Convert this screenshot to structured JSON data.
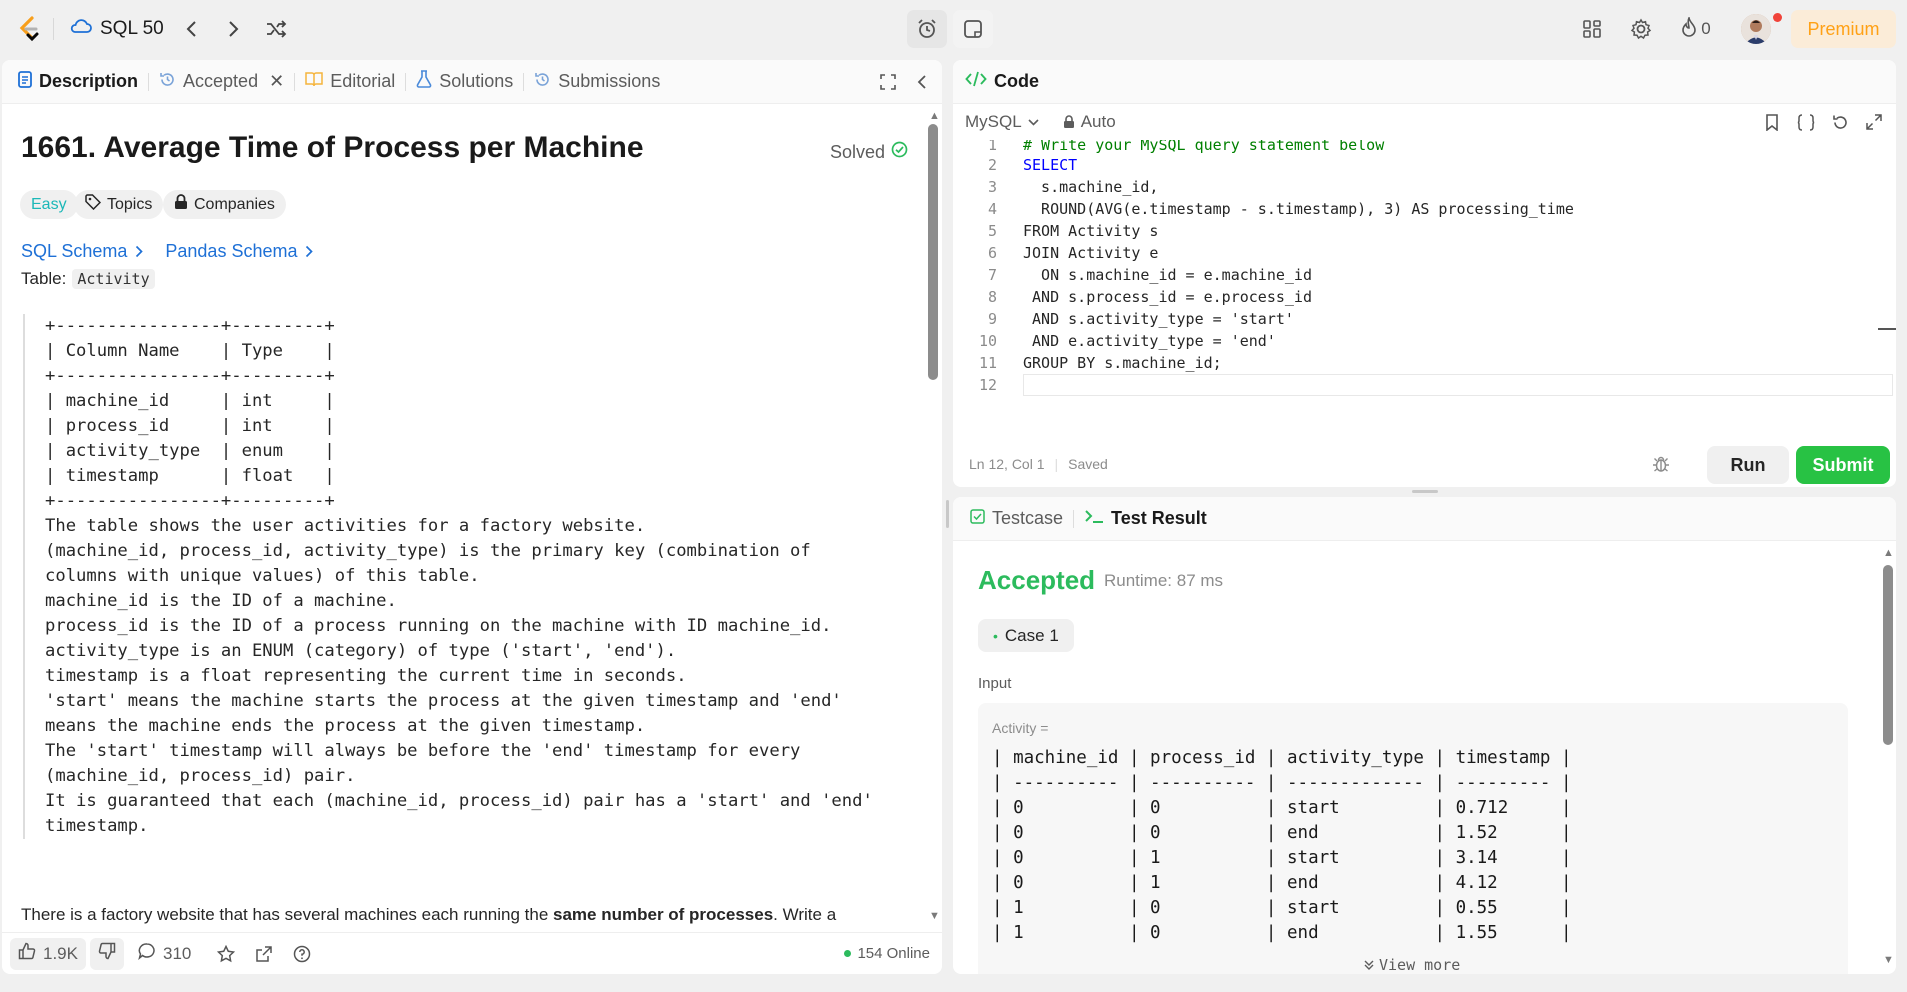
{
  "topbar": {
    "list_name": "SQL 50",
    "streak_count": "0",
    "premium_label": "Premium"
  },
  "left_tabs": [
    {
      "label": "Description"
    },
    {
      "label": "Accepted"
    },
    {
      "label": "Editorial"
    },
    {
      "label": "Solutions"
    },
    {
      "label": "Submissions"
    }
  ],
  "problem": {
    "title": "1661. Average Time of Process per Machine",
    "status": "Solved",
    "difficulty": "Easy",
    "topics_label": "Topics",
    "companies_label": "Companies",
    "sql_schema_link": "SQL Schema",
    "pandas_schema_link": "Pandas Schema",
    "table_label": "Table:",
    "table_name": "Activity",
    "schema_block": "+----------------+---------+\n| Column Name    | Type    |\n+----------------+---------+\n| machine_id     | int     |\n| process_id     | int     |\n| activity_type  | enum    |\n| timestamp      | float   |\n+----------------+---------+\nThe table shows the user activities for a factory website.\n(machine_id, process_id, activity_type) is the primary key (combination of\ncolumns with unique values) of this table.\nmachine_id is the ID of a machine.\nprocess_id is the ID of a process running on the machine with ID machine_id.\nactivity_type is an ENUM (category) of type ('start', 'end').\ntimestamp is a float representing the current time in seconds.\n'start' means the machine starts the process at the given timestamp and 'end'\nmeans the machine ends the process at the given timestamp.\nThe 'start' timestamp will always be before the 'end' timestamp for every\n(machine_id, process_id) pair.\nIt is guaranteed that each (machine_id, process_id) pair has a 'start' and 'end'\ntimestamp.",
    "desc_prefix": "There is a factory website that has several machines each running the ",
    "desc_bold": "same number of processes",
    "desc_suffix": ". Write a"
  },
  "footer": {
    "likes": "1.9K",
    "comments": "310",
    "online": "154 Online"
  },
  "code_panel": {
    "title": "Code",
    "language": "MySQL",
    "auto_label": "Auto",
    "lines": [
      "# Write your MySQL query statement below",
      "SELECT",
      "  s.machine_id,",
      "  ROUND(AVG(e.timestamp - s.timestamp), 3) AS processing_time",
      "FROM Activity s",
      "JOIN Activity e",
      "  ON s.machine_id = e.machine_id",
      " AND s.process_id = e.process_id",
      " AND s.activity_type = 'start'",
      " AND e.activity_type = 'end'",
      "GROUP BY s.machine_id;",
      ""
    ],
    "cursor_pos": "Ln 12, Col 1",
    "save_status": "Saved",
    "run_label": "Run",
    "submit_label": "Submit"
  },
  "result_panel": {
    "tabs": [
      {
        "label": "Testcase"
      },
      {
        "label": "Test Result"
      }
    ],
    "verdict": "Accepted",
    "runtime": "Runtime: 87 ms",
    "case_label": "Case 1",
    "input_label": "Input",
    "activity_label": "Activity =",
    "input_table": "| machine_id | process_id | activity_type | timestamp |\n| ---------- | ---------- | ------------- | --------- |\n| 0          | 0          | start         | 0.712     |\n| 0          | 0          | end           | 1.52      |\n| 0          | 1          | start         | 3.14      |\n| 0          | 1          | end           | 4.12      |\n| 1          | 0          | start         | 0.55      |\n| 1          | 0          | end           | 1.55      |",
    "view_more": "View more"
  },
  "colors": {
    "accent_green": "#2cbb5d",
    "premium_orange": "#ffa116",
    "link_blue": "#1e70d6"
  }
}
